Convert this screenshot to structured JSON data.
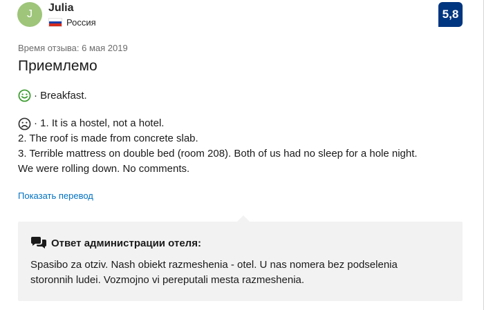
{
  "reviewer": {
    "initial": "J",
    "name": "Julia",
    "country": "Россия",
    "avatar_color": "#9ec57a"
  },
  "score": {
    "value": "5,8",
    "color": "#003580"
  },
  "review": {
    "date_label": "Время отзыва: 6 мая 2019",
    "title": "Приемлемо",
    "positive_icon": "smiley-happy-icon",
    "positive_text": "· Breakfast.",
    "negative_icon": "smiley-sad-icon",
    "negative_lines": [
      "· 1. It is a hostel, not a hotel.",
      "2. The roof is made from concrete slab.",
      "3. Terrible mattress on double bed (room 208). Both of us had no sleep for a hole night.",
      "We were rolling down. No comments."
    ],
    "translate_link": "Показать перевод"
  },
  "hotel_reply": {
    "icon": "speech-bubbles-icon",
    "header": "Ответ администрации отеля:",
    "lines": [
      "Spasibo za otziv. Nash obiekt razmeshenia - otel. U nas nomera bez podselenia",
      "storonnih ludei. Vozmojno vi pereputali mesta razmeshenia."
    ]
  },
  "colors": {
    "link": "#0071c2",
    "positive_icon": "#379a2a",
    "reply_background": "#f2f2f2"
  }
}
